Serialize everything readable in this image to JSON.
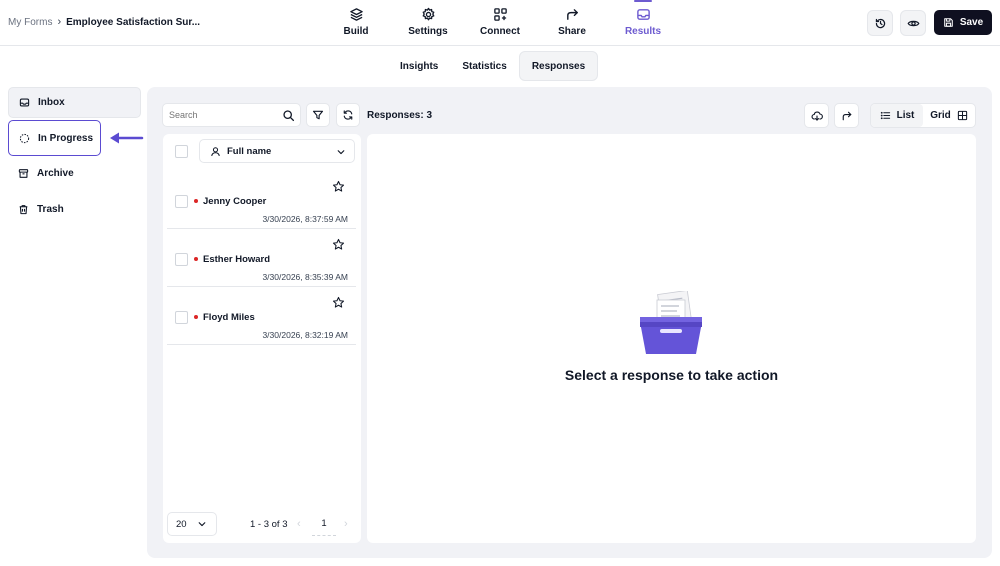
{
  "breadcrumb": {
    "root": "My Forms",
    "separator": "›",
    "current": "Employee Satisfaction Sur..."
  },
  "nav_tabs": [
    {
      "label": "Build",
      "icon": "layers-icon"
    },
    {
      "label": "Settings",
      "icon": "gear-icon"
    },
    {
      "label": "Connect",
      "icon": "connect-icon"
    },
    {
      "label": "Share",
      "icon": "share-arrow-icon"
    },
    {
      "label": "Results",
      "icon": "inbox-icon",
      "active": true
    }
  ],
  "header_actions": {
    "history_icon": "history-icon",
    "preview_icon": "eye-icon",
    "save_label": "Save"
  },
  "sub_tabs": [
    {
      "label": "Insights"
    },
    {
      "label": "Statistics"
    },
    {
      "label": "Responses",
      "active": true
    }
  ],
  "sidebar": {
    "items": [
      {
        "label": "Inbox",
        "icon": "inbox-icon"
      },
      {
        "label": "In Progress",
        "icon": "dashed-circle-icon",
        "highlighted": true
      },
      {
        "label": "Archive",
        "icon": "archive-icon"
      },
      {
        "label": "Trash",
        "icon": "trash-icon"
      }
    ]
  },
  "toolbar": {
    "search_placeholder": "Search",
    "responses_count": "Responses: 3",
    "view_list": "List",
    "view_grid": "Grid"
  },
  "list": {
    "sort_label": "Full name",
    "rows": [
      {
        "name": "Jenny Cooper",
        "date": "3/30/2026, 8:37:59 AM"
      },
      {
        "name": "Esther Howard",
        "date": "3/30/2026, 8:35:39 AM"
      },
      {
        "name": "Floyd Miles",
        "date": "3/30/2026, 8:32:19 AM"
      }
    ],
    "per_page": "20",
    "range": "1 - 3 of 3",
    "page": "1"
  },
  "detail": {
    "empty_message": "Select a response to take action"
  },
  "colors": {
    "accent": "#6d5bd0",
    "dark": "#0f1020",
    "panel_bg": "#f1f2f6",
    "unread_dot": "#dc2626"
  }
}
